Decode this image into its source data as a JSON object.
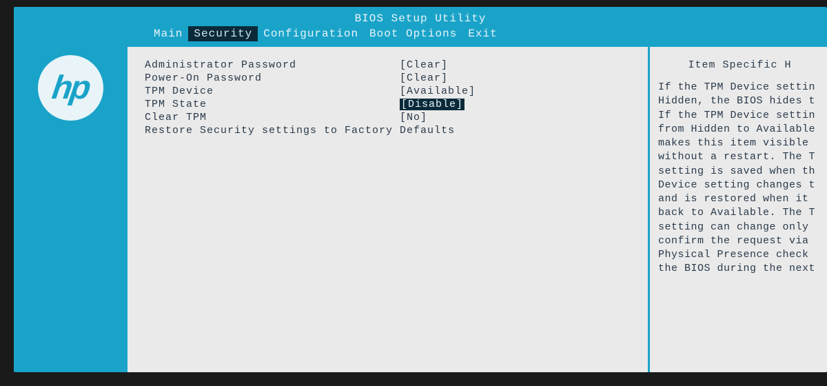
{
  "title": "BIOS Setup Utility",
  "brand": "hp",
  "menu": {
    "items": [
      {
        "label": "Main",
        "selected": false
      },
      {
        "label": "Security",
        "selected": true
      },
      {
        "label": "Configuration",
        "selected": false
      },
      {
        "label": "Boot Options",
        "selected": false
      },
      {
        "label": "Exit",
        "selected": false
      }
    ]
  },
  "settings": [
    {
      "label": "Administrator Password",
      "value": "[Clear]",
      "highlighted": false
    },
    {
      "label": "Power-On Password",
      "value": "[Clear]",
      "highlighted": false
    },
    {
      "label": "TPM Device",
      "value": "[Available]",
      "highlighted": false
    },
    {
      "label": "TPM State",
      "value": "[Disable]",
      "highlighted": true
    },
    {
      "label": "Clear TPM",
      "value": "[No]",
      "highlighted": false
    }
  ],
  "action": {
    "label": "Restore Security settings to Factory Defaults"
  },
  "help": {
    "title": "Item Specific H",
    "text": "If the TPM Device settin\nHidden, the BIOS hides t\nIf the TPM Device settin\nfrom Hidden to Available\nmakes this item visible \nwithout a restart. The T\nsetting is saved when th\nDevice setting changes t\nand is restored when it \nback to Available. The T\nsetting can change only \nconfirm the request via \nPhysical Presence check \nthe BIOS during the next"
  }
}
